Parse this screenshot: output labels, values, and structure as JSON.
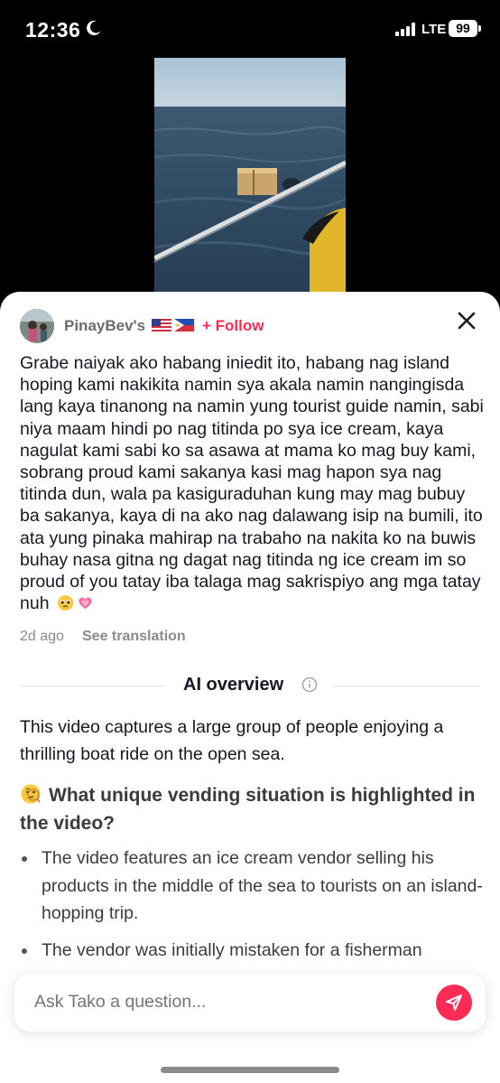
{
  "status": {
    "time": "12:36",
    "network": "LTE",
    "battery": "99"
  },
  "post": {
    "username": "PinayBev's",
    "flags": [
      "US flag",
      "Philippines flag"
    ],
    "follow_label": "+ Follow",
    "description": "Grabe naiyak ako habang iniedit ito, habang nag island hoping kami nakikita namin sya akala namin nangingisda lang kaya tinanong na namin yung tourist guide namin, sabi niya maam hindi po nag titinda po sya ice cream, kaya nagulat kami sabi ko sa asawa at mama ko mag buy kami, sobrang proud kami sakanya kasi mag hapon sya nag titinda dun, wala pa kasiguraduhan kung may mag bubuy ba sakanya, kaya di na ako nag dalawang isip na bumili, ito ata yung pinaka mahirap na trabaho na nakita ko na buwis buhay nasa gitna ng dagat nag titinda ng ice cream im so proud of you tatay iba talaga mag sakrispiyo ang mga tatay nuh",
    "description_emojis": [
      "pleading-face",
      "growing-heart"
    ],
    "time_ago": "2d ago",
    "see_translation": "See translation"
  },
  "ai_overview": {
    "title": "AI overview",
    "summary": "This video captures a large group of people enjoying a thrilling boat ride on the open sea.",
    "question_emoji": "thinking-face",
    "question": "What unique vending situation is highlighted in the video?",
    "bullets": [
      "The video features an ice cream vendor selling his products in the middle of the sea to tourists on an island-hopping trip.",
      "The vendor was initially mistaken for a fisherman"
    ]
  },
  "ask_bar": {
    "placeholder": "Ask Tako a question..."
  },
  "colors": {
    "accent": "#fe2c55",
    "text": "#161823",
    "muted": "#8a8b91"
  },
  "icons": [
    "moon-icon",
    "signal-icon",
    "battery-icon",
    "close-icon",
    "info-icon",
    "send-icon"
  ]
}
